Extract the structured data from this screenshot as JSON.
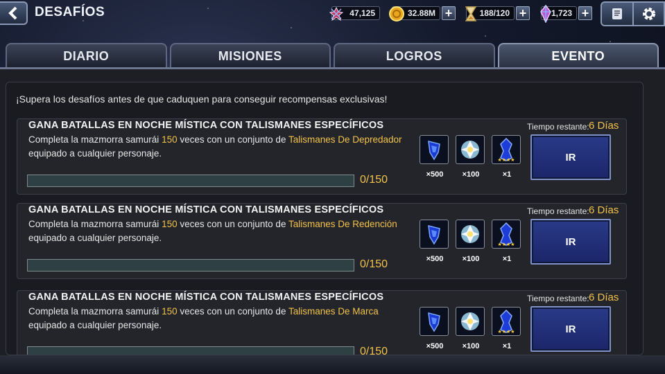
{
  "header": {
    "title": "DESAFÍOS"
  },
  "resources": [
    {
      "name": "units",
      "value": "47,125",
      "icon": "unit-icon",
      "has_plus": false
    },
    {
      "name": "gold",
      "value": "32.88M",
      "icon": "gold-coin-icon",
      "has_plus": true
    },
    {
      "name": "stamina",
      "value": "188/120",
      "icon": "hourglass-icon",
      "has_plus": true
    },
    {
      "name": "crystals",
      "value": "1,723",
      "icon": "crystal-icon",
      "has_plus": true
    }
  ],
  "tabs": [
    {
      "label": "DIARIO",
      "active": false
    },
    {
      "label": "MISIONES",
      "active": false
    },
    {
      "label": "LOGROS",
      "active": false
    },
    {
      "label": "EVENTO",
      "active": true
    }
  ],
  "intro": "¡Supera los desafíos antes de que caduquen para conseguir recompensas exclusivas!",
  "challenges": [
    {
      "title": "GANA BATALLAS EN NOCHE MÍSTICA CON TALISMANES ESPECÍFICOS",
      "desc_1": "Completa la mazmorra samurái ",
      "desc_count": "150",
      "desc_2": " veces con un conjunto de ",
      "desc_set": "Talismanes De Depredador",
      "desc_3": " equipado a cualquier personaje.",
      "progress": "0/150",
      "progress_fraction": 0,
      "time_label": "Tiempo restante:",
      "time_value": "6 Días",
      "button": "IR",
      "rewards": [
        {
          "count": "×500",
          "icon": "talisman-icon"
        },
        {
          "count": "×100",
          "icon": "crystal-shard-icon"
        },
        {
          "count": "×1",
          "icon": "blue-talisman-4star-icon",
          "stars": "★★★★"
        }
      ]
    },
    {
      "title": "GANA BATALLAS EN NOCHE MÍSTICA CON TALISMANES ESPECÍFICOS",
      "desc_1": "Completa la mazmorra samurái ",
      "desc_count": "150",
      "desc_2": " veces con un conjunto de ",
      "desc_set": "Talismanes De Redención",
      "desc_3": " equipado a cualquier personaje.",
      "progress": "0/150",
      "progress_fraction": 0,
      "time_label": "Tiempo restante:",
      "time_value": "6 Días",
      "button": "IR",
      "rewards": [
        {
          "count": "×500",
          "icon": "talisman-icon"
        },
        {
          "count": "×100",
          "icon": "crystal-shard-icon"
        },
        {
          "count": "×1",
          "icon": "blue-talisman-4star-icon",
          "stars": "★★★★"
        }
      ]
    },
    {
      "title": "GANA BATALLAS EN NOCHE MÍSTICA CON TALISMANES ESPECÍFICOS",
      "desc_1": "Completa la mazmorra samurái ",
      "desc_count": "150",
      "desc_2": " veces con un conjunto de ",
      "desc_set": "Talismanes De Marca",
      "desc_3": " equipado a cualquier personaje.",
      "progress": "0/150",
      "progress_fraction": 0,
      "time_label": "Tiempo restante:",
      "time_value": "6 Días",
      "button": "IR",
      "rewards": [
        {
          "count": "×500",
          "icon": "talisman-icon"
        },
        {
          "count": "×100",
          "icon": "crystal-shard-icon"
        },
        {
          "count": "×1",
          "icon": "blue-talisman-4star-icon",
          "stars": "★★★★"
        }
      ]
    }
  ],
  "colors": {
    "accent_gold": "#f3c24a",
    "button_blue": "#1f2d78",
    "panel": "#1d1f24"
  }
}
